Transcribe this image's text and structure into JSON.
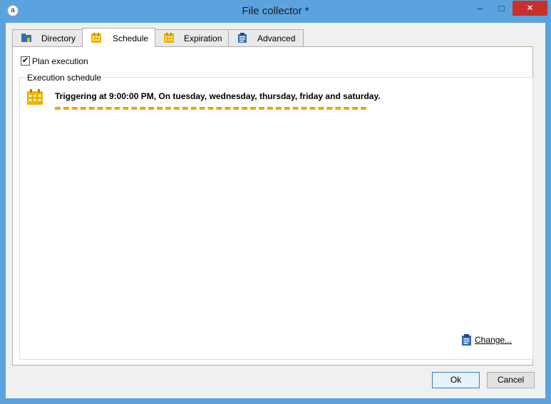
{
  "window": {
    "title": "File collector *",
    "app_icon": "app-logo-icon",
    "controls": {
      "minimize": "–",
      "maximize": "□",
      "close": "✕"
    }
  },
  "tabs": [
    {
      "label": "Directory",
      "icon": "folder-icon",
      "active": false
    },
    {
      "label": "Schedule",
      "icon": "calendar-icon",
      "active": true
    },
    {
      "label": "Expiration",
      "icon": "calendar-icon",
      "active": false
    },
    {
      "label": "Advanced",
      "icon": "clipboard-icon",
      "active": false
    }
  ],
  "schedule": {
    "plan_execution_label": "Plan execution",
    "plan_execution_checked": true,
    "group_title": "Execution schedule",
    "trigger_text": "Triggering at 9:00:00 PM, On tuesday, wednesday, thursday, friday and saturday.",
    "change_link": "Change..."
  },
  "footer": {
    "ok_label": "Ok",
    "cancel_label": "Cancel"
  },
  "colors": {
    "titlebar": "#5ba3e0",
    "close_button": "#c7302b",
    "accent_dash": "#f3a01f",
    "calendar_icon": "#f0b400"
  }
}
